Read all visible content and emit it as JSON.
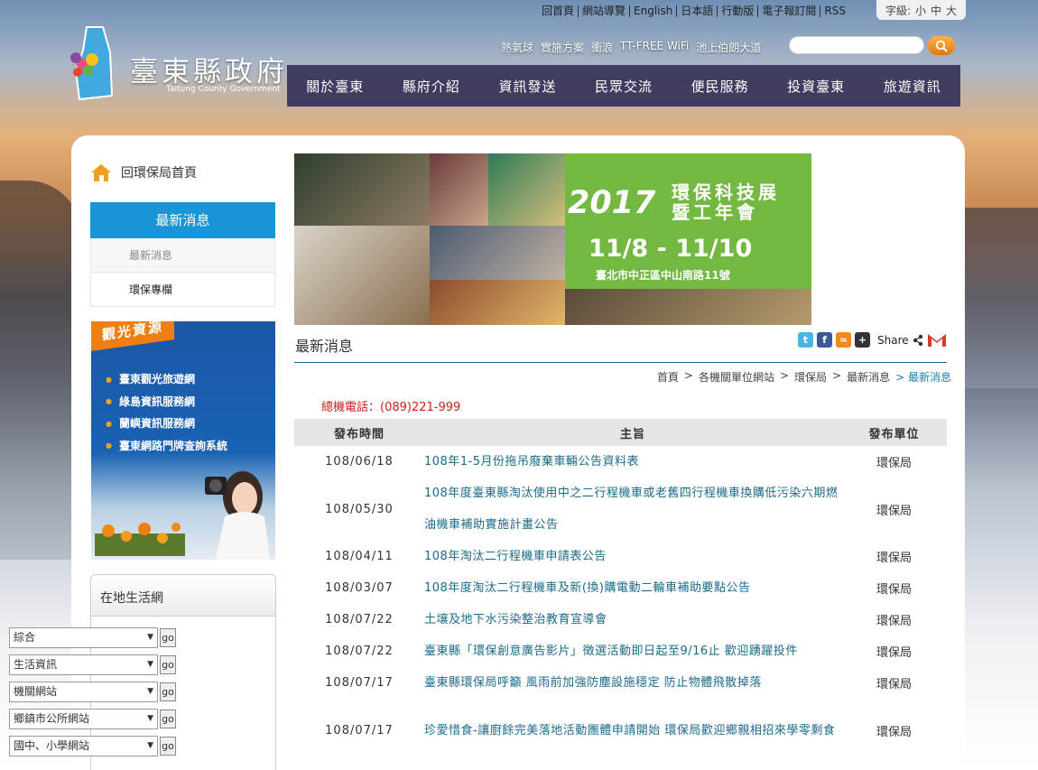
{
  "site": {
    "title": "臺東縣政府",
    "subtitle": "Taitung County Government"
  },
  "util_links": [
    "回首頁",
    "網站導覽",
    "English",
    "日本語",
    "行動版",
    "電子報訂閱",
    "RSS"
  ],
  "font_size": {
    "label": "字級:",
    "options": [
      "小",
      "中",
      "大"
    ]
  },
  "quick_links": [
    "熱氣球",
    "實施方案",
    "衝浪",
    "TT-FREE WiFi",
    "池上伯朗大道"
  ],
  "search": {
    "placeholder": ""
  },
  "nav": [
    "關於臺東",
    "縣府介紹",
    "資訊發送",
    "民眾交流",
    "便民服務",
    "投資臺東",
    "旅遊資訊"
  ],
  "sidebar": {
    "home_link": "回環保局首頁",
    "menu_head": "最新消息",
    "menu_items": [
      "最新消息",
      "環保專欄"
    ]
  },
  "tour": {
    "tag": "觀光資源",
    "links": [
      "臺東觀光旅遊網",
      "綠島資訊服務網",
      "蘭嶼資訊服務網",
      "臺東網路門牌查詢系統"
    ]
  },
  "life": {
    "title": "在地生活網",
    "go_label": "go",
    "selects": [
      "綜合",
      "生活資訊",
      "機關網站",
      "鄉鎮市公所網站",
      "國中、小學網站"
    ]
  },
  "banner": {
    "year": "2017",
    "title_line1": "環保科技展",
    "title_line2": "暨工年會",
    "date": "11/8 - 11/10",
    "address": "臺北市中正區中山南路11號"
  },
  "page_title": "最新消息",
  "share": {
    "label": "Share"
  },
  "breadcrumb": [
    "首頁",
    "各機關單位網站",
    "環保局",
    "最新消息",
    "最新消息"
  ],
  "phone": "總機電話：(089)221-999",
  "table": {
    "headers": [
      "發布時間",
      "主旨",
      "發布單位"
    ],
    "rows": [
      {
        "date": "108/06/18",
        "subject": "108年1-5月份拖吊廢棄車輛公告資料表",
        "unit": "環保局"
      },
      {
        "date": "108/05/30",
        "subject": "108年度臺東縣淘汰使用中之二行程機車或老舊四行程機車換購低污染六期燃油機車補助實施計畫公告",
        "unit": "環保局"
      },
      {
        "date": "108/04/11",
        "subject": "108年淘汰二行程機車申請表公告",
        "unit": "環保局"
      },
      {
        "date": "108/03/07",
        "subject": "108年度淘汰二行程機車及新(換)購電動二輪車補助要點公告",
        "unit": "環保局"
      },
      {
        "date": "108/07/22",
        "subject": "土壤及地下水污染整治教育宣導會",
        "unit": "環保局"
      },
      {
        "date": "108/07/22",
        "subject": "臺東縣「環保創意廣告影片」徵選活動即日起至9/16止 歡迎踴躍投件",
        "unit": "環保局"
      },
      {
        "date": "108/07/17",
        "subject": "臺東縣環保局呼籲 風雨前加強防塵設施穩定 防止物體飛散掉落",
        "unit": "環保局"
      },
      {
        "date": "108/07/17",
        "subject": "珍愛惜食-讓廚餘完美落地活動團體申請開始 環保局歡迎鄉親相招來學零剩食",
        "unit": "環保局"
      }
    ]
  },
  "colors": {
    "nav_bg": "#343258",
    "menu_head": "#1795d4",
    "link": "#1a6b8a",
    "phone": "#d0201a",
    "tour_tag": "#f07f12"
  }
}
